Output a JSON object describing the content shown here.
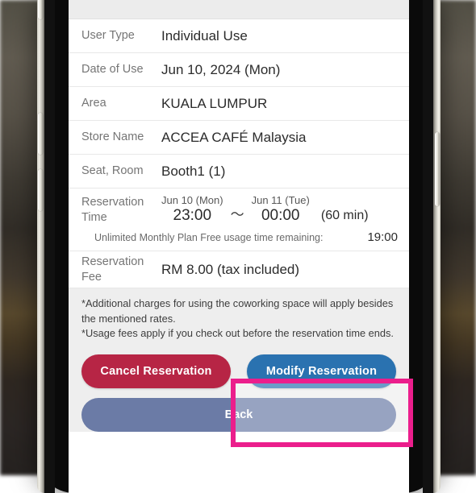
{
  "reservation": {
    "rows": [
      {
        "label": "User Type",
        "value": "Individual Use"
      },
      {
        "label": "Date of Use",
        "value": "Jun 10, 2024 (Mon)"
      },
      {
        "label": "Area",
        "value": "KUALA LUMPUR"
      },
      {
        "label": "Store Name",
        "value": "ACCEA CAFÉ Malaysia"
      },
      {
        "label": "Seat, Room",
        "value": "Booth1  (1)"
      }
    ],
    "time": {
      "label": "Reservation Time",
      "start_date": "Jun 10 (Mon)",
      "start_time": "23:00",
      "separator": "～",
      "end_date": "Jun 11 (Tue)",
      "end_time": "00:00",
      "duration": "(60 min)"
    },
    "plan": {
      "text": "Unlimited Monthly Plan Free usage time remaining:",
      "remaining": "19:00"
    },
    "fee": {
      "label": "Reservation Fee",
      "value": "RM 8.00 (tax included)"
    }
  },
  "notes": {
    "line1": "*Additional charges for using the coworking space will apply besides the mentioned rates.",
    "line2": "*Usage fees apply if you check out before the reservation time ends."
  },
  "buttons": {
    "cancel": "Cancel Reservation",
    "modify": "Modify Reservation",
    "back": "Back"
  },
  "colors": {
    "cancel_bg": "#b72545",
    "modify_bg": "#2a72b0",
    "back_bg": "#6b7ba6",
    "highlight": "#eb1e8c",
    "panel_bg": "#eeeeee"
  }
}
